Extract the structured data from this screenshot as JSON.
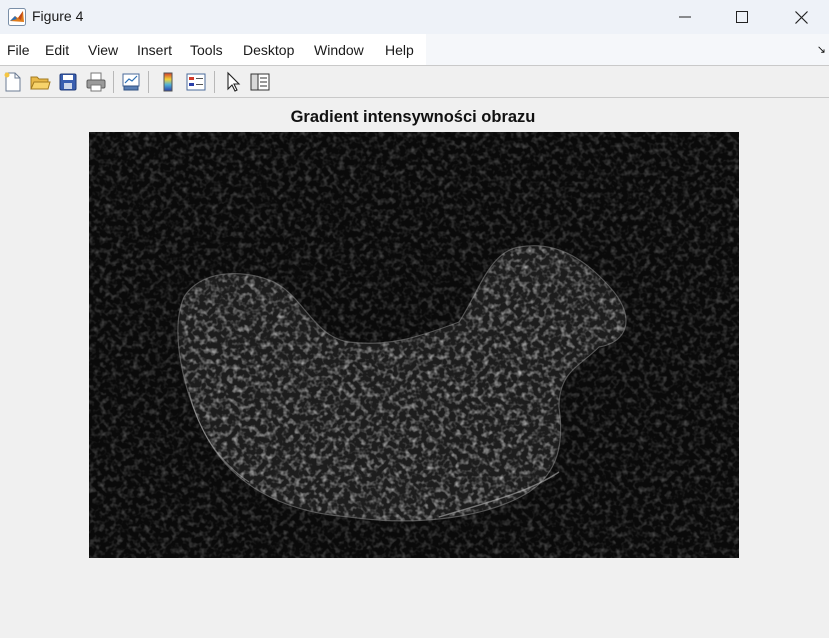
{
  "window": {
    "title": "Figure 4"
  },
  "menu": {
    "items": [
      "File",
      "Edit",
      "View",
      "Insert",
      "Tools",
      "Desktop",
      "Window",
      "Help"
    ]
  },
  "toolbar": {
    "buttons": [
      "new-figure",
      "open-file",
      "save-figure",
      "print-figure",
      "link-plot",
      "insert-colorbar",
      "insert-legend",
      "edit-plot",
      "property-inspector"
    ]
  },
  "figure": {
    "title": "Gradient intensywności obrazu"
  }
}
